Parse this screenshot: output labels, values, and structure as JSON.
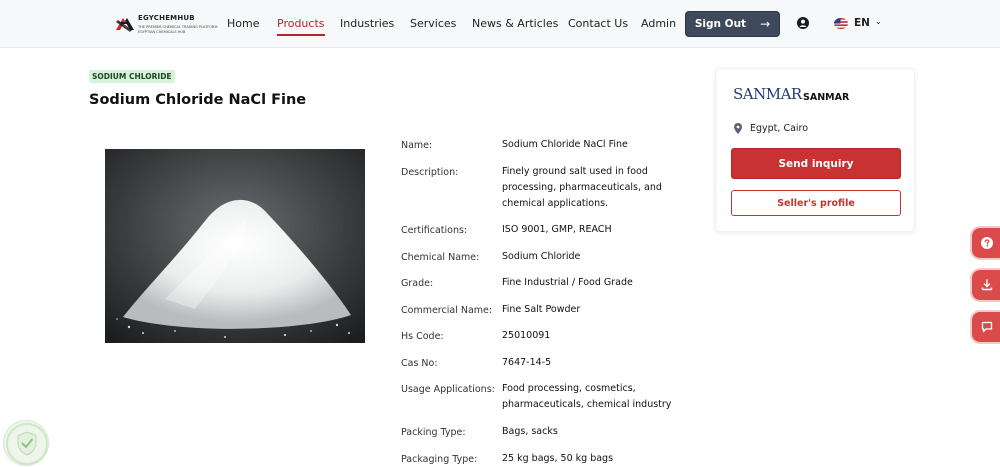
{
  "nav": {
    "logo_text": "EGYCHEMHUB",
    "logo_tagline_1": "THE PREMIER CHEMICAL TRADING PLATFORM",
    "logo_tagline_2": "EGYPTIAN CHEMICALS HUB",
    "links": [
      {
        "label": "Home",
        "active": false
      },
      {
        "label": "Products",
        "active": true
      },
      {
        "label": "Industries",
        "active": false
      },
      {
        "label": "Services",
        "active": false
      },
      {
        "label": "News & Articles",
        "active": false
      },
      {
        "label": "Contact Us",
        "active": false
      },
      {
        "label": "Admin",
        "active": false
      }
    ],
    "sign_out_label": "Sign Out",
    "sign_out_arrow": "→",
    "language": "EN",
    "user_icon": "user-circle-icon",
    "flag_icon": "us-flag-icon"
  },
  "product": {
    "badge": "SODIUM CHLORIDE",
    "title": "Sodium Chloride NaCl Fine",
    "specs": [
      {
        "label": "Name:",
        "value": "Sodium Chloride NaCl Fine"
      },
      {
        "label": "Description:",
        "value": "Finely ground salt used in food processing, pharmaceuticals, and chemical applications."
      },
      {
        "label": "Certifications:",
        "value": "ISO 9001, GMP, REACH"
      },
      {
        "label": "Chemical Name:",
        "value": "Sodium Chloride"
      },
      {
        "label": "Grade:",
        "value": "Fine Industrial / Food Grade"
      },
      {
        "label": "Commercial Name:",
        "value": "Fine Salt Powder"
      },
      {
        "label": "Hs Code:",
        "value": "25010091"
      },
      {
        "label": "Cas No:",
        "value": "7647-14-5"
      },
      {
        "label": "Usage Applications:",
        "value": "Food processing, cosmetics, pharmaceuticals, chemical industry"
      },
      {
        "label": "Packing Type:",
        "value": "Bags, sacks"
      },
      {
        "label": "Packaging Type:",
        "value": "25 kg bags, 50 kg bags"
      }
    ]
  },
  "seller": {
    "logo_text": "SANMAR",
    "name": "SANMAR",
    "location": "Egypt, Cairo",
    "send_inquiry_label": "Send inquiry",
    "profile_label": "Seller's profile"
  },
  "side_buttons": [
    {
      "icon": "question-icon"
    },
    {
      "icon": "download-icon"
    },
    {
      "icon": "chat-icon"
    }
  ],
  "colors": {
    "brand_red": "#c83232",
    "nav_active": "#b3262b",
    "sign_out_bg": "#3e4a5c",
    "badge_bg": "#d9f2dc"
  }
}
